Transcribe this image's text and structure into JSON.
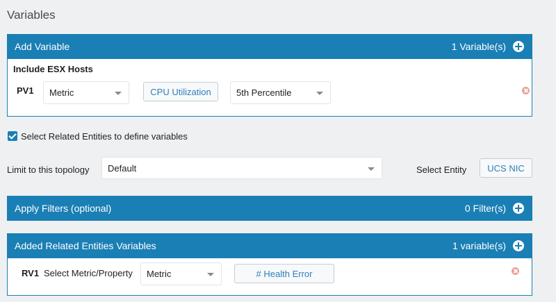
{
  "page_title": "Variables",
  "add_variable": {
    "title": "Add Variable",
    "count_label": "1 Variable(s)",
    "group_label": "Include ESX Hosts",
    "row": {
      "id": "PV1",
      "type_select": "Metric",
      "metric_button": "CPU Utilization",
      "aggregation_select": "5th Percentile"
    }
  },
  "related": {
    "checkbox_label": "Select Related Entities to define variables",
    "checked": true,
    "topology_label": "Limit to this topology",
    "topology_select": "Default",
    "entity_label": "Select Entity",
    "entity_button": "UCS NIC"
  },
  "filters": {
    "title": "Apply Filters (optional)",
    "count_label": "0 Filter(s)"
  },
  "related_vars": {
    "title": "Added Related Entities Variables",
    "count_label": "1 variable(s)",
    "row": {
      "id": "RV1",
      "label": "Select Metric/Property",
      "type_select": "Metric",
      "metric_button": "# Health Error"
    }
  },
  "colors": {
    "header_blue": "#1a7fb5",
    "link_blue": "#2f7fb8",
    "remove_icon": "#ef9e98",
    "background": "#eef0f2"
  }
}
